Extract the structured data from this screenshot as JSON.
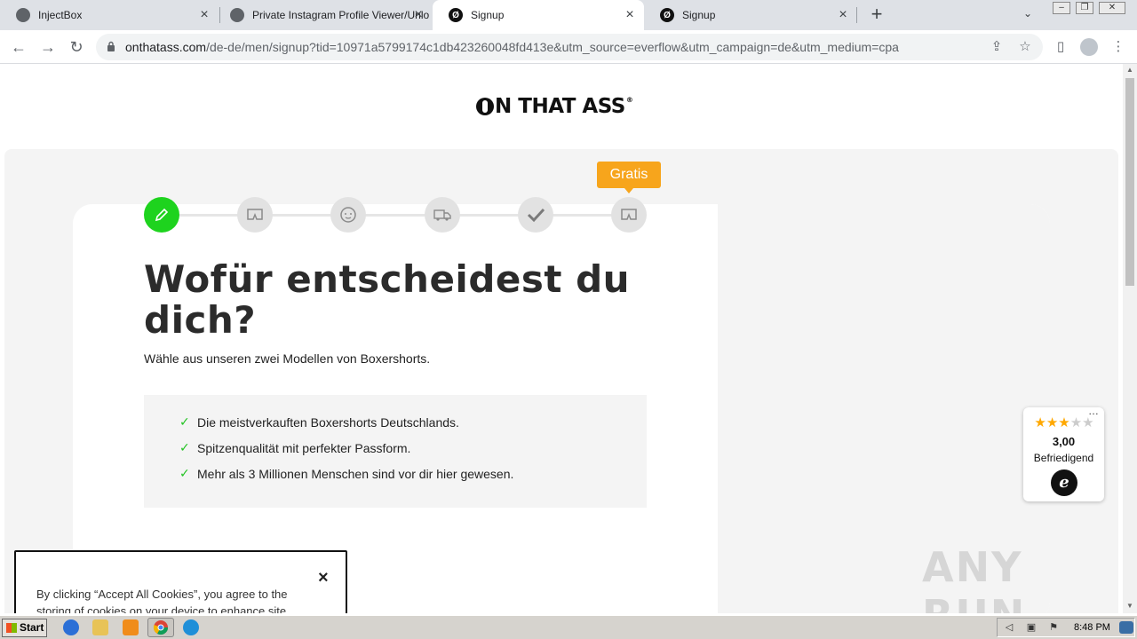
{
  "tabs": [
    {
      "title": "InjectBox",
      "active": false
    },
    {
      "title": "Private Instagram Profile Viewer/Unlo",
      "active": false
    },
    {
      "title": "Signup",
      "active": true
    },
    {
      "title": "Signup",
      "active": false
    }
  ],
  "url": {
    "host": "onthatass.com",
    "path": "/de-de/men/signup?tid=10971a5799174c1db423260048fd413e&utm_source=everflow&utm_campaign=de&utm_medium=cpa"
  },
  "page": {
    "logo_text": "N THAT ASS",
    "logo_reg": "®",
    "badge": "Gratis",
    "headline": "Wofür entscheidest du dich?",
    "subline": "Wähle aus unseren zwei Modellen von Boxershorts.",
    "benefits": [
      "Die meistverkauften Boxershorts Deutschlands.",
      "Spitzenqualität mit perfekter Passform.",
      "Mehr als 3 Millionen Menschen sind vor dir hier gewesen."
    ],
    "steps_total": 6,
    "current_step": 1
  },
  "trust_badge": {
    "rating": 3,
    "max_rating": 5,
    "score_text": "3,00",
    "grade": "Befriedigend",
    "mark": "e"
  },
  "cookie_banner": {
    "text": "By clicking “Accept All Cookies”, you agree to the storing of cookies on your device to enhance site",
    "close": "×"
  },
  "watermark": "ANY RUN",
  "taskbar": {
    "start": "Start",
    "time": "8:48 PM"
  },
  "colors": {
    "accent_green": "#1ed31e",
    "badge_orange": "#f7a51c",
    "check_green": "#22c322"
  }
}
